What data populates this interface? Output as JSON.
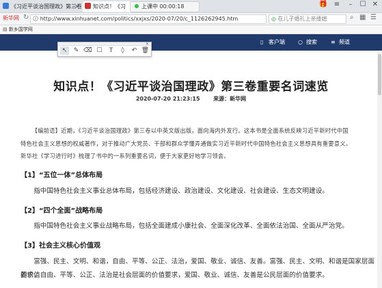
{
  "browser": {
    "tabs": [
      {
        "label": "《习近平谈治国理政》第三卷"
      },
      {
        "label": "知识点！《习"
      }
    ],
    "recording": {
      "label": "上课中 00:00:18"
    },
    "url": "http://www.xinhuanet.com/politics/xxjxs/2020-07/20/c_1126262945.htm",
    "search_text": "在儿子婚礼上亲搂媳",
    "site_tag": "新华网",
    "bookmark": "新乡国学网"
  },
  "site_header": {
    "client": "客户端",
    "search": "搜索",
    "channels": "频道"
  },
  "drawing_toolbar": {
    "tools": [
      "cursor-icon",
      "pen-icon",
      "eraser-icon",
      "rectangle-icon",
      "text-icon",
      "highlighter-icon",
      "undo-icon",
      "trash-icon"
    ]
  },
  "article": {
    "title": "知识点！《习近平谈治国理政》第三卷重要名词速览",
    "date": "2020-07-20 21:23:15",
    "source": "来源：新华网",
    "lead_lines": [
      "【编前语】近期，《习近平谈治国理政》第三卷以中英文版出版，面向海内外发行。这本书是全面系统反映习近平新时代中国",
      "特色社会主义思想的权威著作，对于推动广大党员、干部和群众学懂弄通做实习近平新时代中国特色社会主义思想具有重要意义。",
      "新华社《学习进行时》梳理了书中的一系列重要名词，便于大家更好地学习领会。"
    ],
    "sections": [
      {
        "heading": "【1】“五位一体”总体布局",
        "lines": [
          "指中国特色社会主义事业总体布局，包括经济建设、政治建设、文化建设、社会建设、生态文明建设。"
        ]
      },
      {
        "heading": "【2】“四个全面”战略布局",
        "lines": [
          "指中国特色社会主义事业战略布局，包括全面建成小康社会、全面深化改革、全面依法治国、全面从严治党。"
        ]
      },
      {
        "heading": "【3】社会主义核心价值观",
        "lines": [
          "富强、民主、文明、和谐，自由、平等、公正、法治，爱国、敬业、诚信、友善。富强、民主、文明、和谐是国家层面的价值",
          "要求，自由、平等、公正、法治是社会层面的价值要求，爱国、敬业、诚信、友善是公民层面的价值要求。"
        ]
      }
    ]
  }
}
